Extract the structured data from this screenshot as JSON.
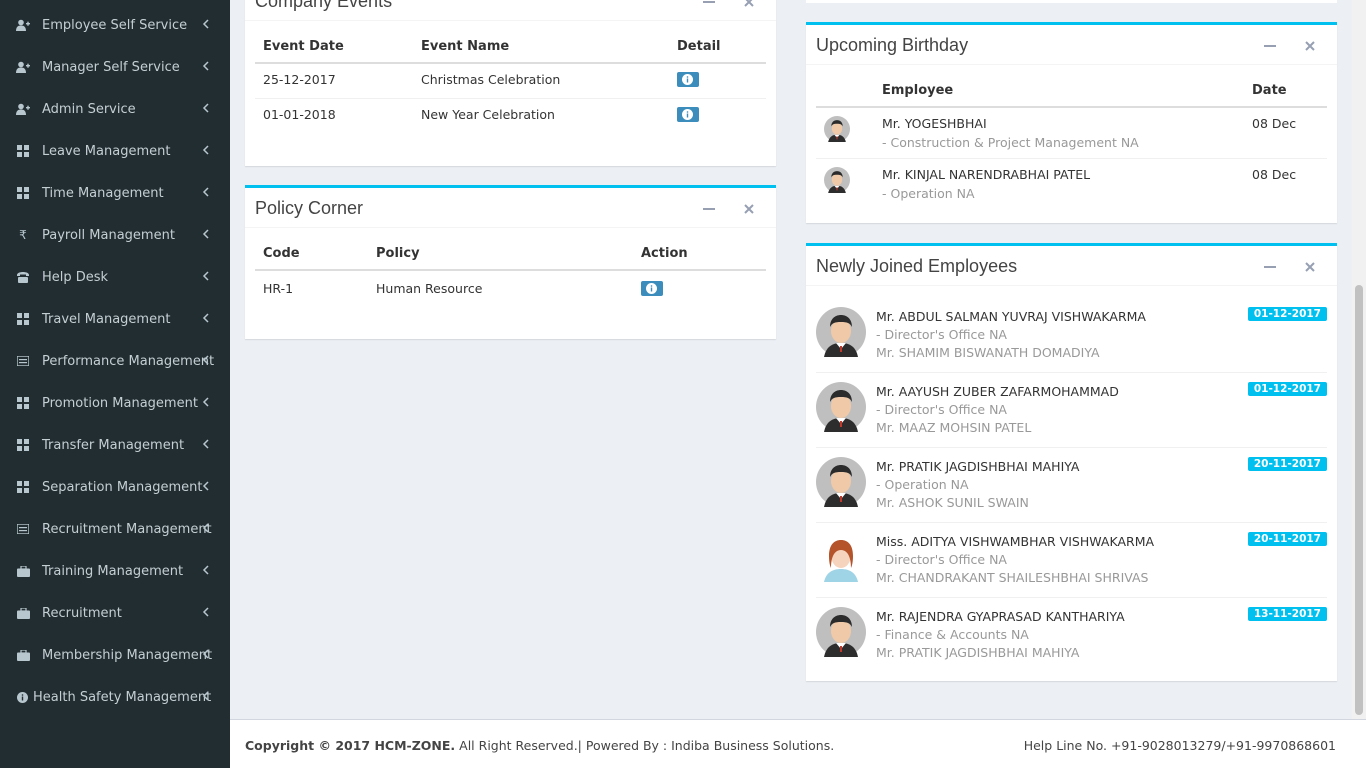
{
  "sidebar": {
    "items": [
      {
        "label": "Employee Self Service",
        "icon": "user-plus-icon"
      },
      {
        "label": "Manager Self Service",
        "icon": "user-plus-icon"
      },
      {
        "label": "Admin Service",
        "icon": "user-plus-icon"
      },
      {
        "label": "Leave Management",
        "icon": "grid-icon"
      },
      {
        "label": "Time Management",
        "icon": "grid-icon"
      },
      {
        "label": "Payroll Management",
        "icon": "rupee-icon"
      },
      {
        "label": "Help Desk",
        "icon": "phone-icon"
      },
      {
        "label": "Travel Management",
        "icon": "grid-icon"
      },
      {
        "label": "Performance Management",
        "icon": "list-icon"
      },
      {
        "label": "Promotion Management",
        "icon": "grid-icon"
      },
      {
        "label": "Transfer Management",
        "icon": "grid-icon"
      },
      {
        "label": "Separation Management",
        "icon": "grid-icon"
      },
      {
        "label": "Recruitment Management",
        "icon": "list-icon"
      },
      {
        "label": "Training Management",
        "icon": "briefcase-icon"
      },
      {
        "label": "Recruitment",
        "icon": "briefcase-icon"
      },
      {
        "label": "Membership Management",
        "icon": "briefcase-icon"
      },
      {
        "label": "Health Safety Management",
        "icon": "info-circle-icon"
      }
    ]
  },
  "company_events": {
    "title": "Company Events",
    "headers": [
      "Event Date",
      "Event Name",
      "Detail"
    ],
    "rows": [
      {
        "date": "25-12-2017",
        "name": "Christmas Celebration"
      },
      {
        "date": "01-01-2018",
        "name": "New Year Celebration"
      }
    ]
  },
  "policy_corner": {
    "title": "Policy Corner",
    "headers": [
      "Code",
      "Policy",
      "Action"
    ],
    "rows": [
      {
        "code": "HR-1",
        "policy": "Human Resource"
      }
    ]
  },
  "upcoming_birthday": {
    "title": "Upcoming Birthday",
    "headers": [
      "Employee",
      "Date"
    ],
    "rows": [
      {
        "name": "Mr. YOGESHBHAI",
        "dept": "- Construction & Project Management NA",
        "date": "08 Dec"
      },
      {
        "name": "Mr. KINJAL NARENDRABHAI PATEL",
        "dept": "- Operation NA",
        "date": "08 Dec"
      }
    ]
  },
  "newly_joined": {
    "title": "Newly Joined Employees",
    "rows": [
      {
        "name": "Mr. ABDUL SALMAN YUVRAJ VISHWAKARMA",
        "dept": "- Director's Office NA",
        "manager": "Mr. SHAMIM BISWANATH DOMADIYA",
        "date": "01-12-2017",
        "avatar": "male-avatar-icon"
      },
      {
        "name": "Mr. AAYUSH ZUBER ZAFARMOHAMMAD",
        "dept": "- Director's Office NA",
        "manager": "Mr. MAAZ MOHSIN PATEL",
        "date": "01-12-2017",
        "avatar": "male-avatar-icon"
      },
      {
        "name": "Mr. PRATIK JAGDISHBHAI MAHIYA",
        "dept": "- Operation NA",
        "manager": "Mr. ASHOK SUNIL SWAIN",
        "date": "20-11-2017",
        "avatar": "male-avatar-icon"
      },
      {
        "name": "Miss. ADITYA VISHWAMBHAR VISHWAKARMA",
        "dept": "- Director's Office NA",
        "manager": "Mr. CHANDRAKANT SHAILESHBHAI SHRIVAS",
        "date": "20-11-2017",
        "avatar": "female-avatar-icon"
      },
      {
        "name": "Mr. RAJENDRA GYAPRASAD KANTHARIYA",
        "dept": "- Finance & Accounts NA",
        "manager": "Mr. PRATIK JAGDISHBHAI MAHIYA",
        "date": "13-11-2017",
        "avatar": "male-avatar-icon"
      }
    ]
  },
  "footer": {
    "copyright_bold": "Copyright © 2017 HCM-ZONE.",
    "copyright_rest": " All Right Reserved.| Powered By : Indiba Business Solutions.",
    "helpline": "Help Line No. +91-9028013279/+91-9970868601"
  },
  "colors": {
    "sidebar_bg": "#222d32",
    "box_accent": "#00c0ef",
    "info_button": "#3c8dbc"
  }
}
